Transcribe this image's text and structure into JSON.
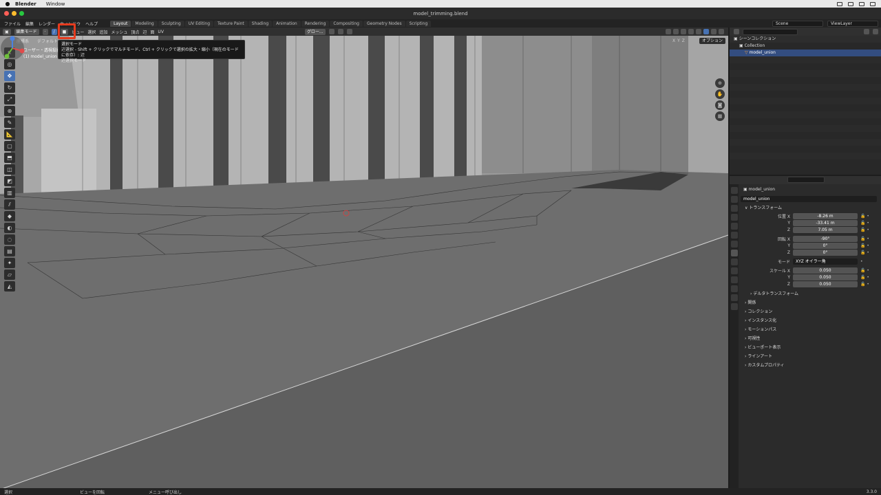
{
  "mac_menu": {
    "app": "Blender",
    "window": "Window"
  },
  "window": {
    "title": "model_trimming.blend"
  },
  "top_menu": [
    "ファイル",
    "編集",
    "レンダー",
    "ウィンドウ",
    "ヘルプ"
  ],
  "workspaces": [
    "Layout",
    "Modeling",
    "Sculpting",
    "UV Editing",
    "Texture Paint",
    "Shading",
    "Animation",
    "Rendering",
    "Compositing",
    "Geometry Nodes",
    "Scripting"
  ],
  "scene": {
    "name": "Scene",
    "view_layer": "ViewLayer"
  },
  "viewport_header": {
    "mode": "編集モード",
    "menus": [
      "ビュー",
      "選択",
      "追加",
      "メッシュ",
      "頂点",
      "辺",
      "面",
      "UV"
    ],
    "transform": "グロー..."
  },
  "viewport": {
    "sub_label": "座標系",
    "default_label": "デフォルト",
    "view_name": "ユーザー・透視投影",
    "object_line": "(1) model_union",
    "option": "オプション",
    "axes": [
      "X",
      "Y",
      "Z"
    ]
  },
  "tooltip": {
    "title": "選択モード",
    "line1": "辺選択 - Shift + クリックでマルチモード、Ctrl + クリックで選択の拡大・縮小（現在のモードに依存）: 辺",
    "line2": "辺選択モード"
  },
  "outliner": {
    "scene_collection": "シーンコレクション",
    "collection": "Collection",
    "object": "model_union"
  },
  "properties": {
    "object_name": "model_union",
    "object_field": "model_union",
    "transform_header": "トランスフォーム",
    "location_label": "位置 X",
    "location": [
      "-8.26 m",
      "-33.41 m",
      "7.05 m"
    ],
    "rotation_label": "回転 X",
    "rotation": [
      "-90°",
      "0°",
      "0°"
    ],
    "mode_label": "モード",
    "mode_value": "XYZ オイラー角",
    "scale_label": "スケール X",
    "scale": [
      "0.050",
      "0.050",
      "0.050"
    ],
    "axis_y": "Y",
    "axis_z": "Z",
    "sections": [
      "デルタトランスフォーム",
      "関係",
      "コレクション",
      "インスタンス化",
      "モーションパス",
      "可視性",
      "ビューポート表示",
      "ラインアート",
      "カスタムプロパティ"
    ]
  },
  "status_bar": {
    "left": "選択",
    "middle": "ビューを回転",
    "right": "メニュー呼び出し",
    "version": "3.3.0"
  },
  "colors": {
    "accent": "#4772b3",
    "highlight": "#e63b1e",
    "viewport": "#3d3d3d"
  }
}
